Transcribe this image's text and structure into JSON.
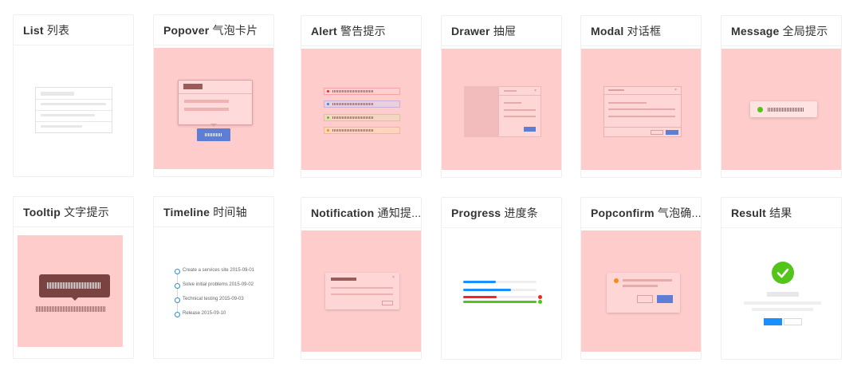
{
  "cards": [
    {
      "title": "List",
      "title_cn": "列表"
    },
    {
      "title": "Popover",
      "title_cn": "气泡卡片"
    },
    {
      "title": "Alert",
      "title_cn": "警告提示"
    },
    {
      "title": "Drawer",
      "title_cn": "抽屉"
    },
    {
      "title": "Modal",
      "title_cn": "对话框"
    },
    {
      "title": "Message",
      "title_cn": "全局提示"
    },
    {
      "title": "Tooltip",
      "title_cn": "文字提示"
    },
    {
      "title": "Timeline",
      "title_cn": "时间轴"
    },
    {
      "title": "Notification",
      "title_cn": "通知提..."
    },
    {
      "title": "Progress",
      "title_cn": "进度条"
    },
    {
      "title": "Popconfirm",
      "title_cn": "气泡确..."
    },
    {
      "title": "Result",
      "title_cn": "结果"
    }
  ],
  "timeline": {
    "items": [
      "Create a services site 2015-09-01",
      "Solve initial problems 2015-09-02",
      "Technical testing 2015-09-03",
      "Release 2015-09-10"
    ]
  },
  "progress": {
    "values": [
      0.45,
      0.65,
      0.55,
      1.0
    ]
  },
  "colors": {
    "highlight": "#ffcccc",
    "primary": "#1890ff",
    "success": "#52c41a",
    "error": "#f5222d",
    "warning": "#faad14",
    "dark_tooltip": "#7b4242"
  },
  "icons": {
    "result": "check-circle-icon",
    "message": "check-circle-icon",
    "popconfirm": "exclamation-circle-icon"
  }
}
